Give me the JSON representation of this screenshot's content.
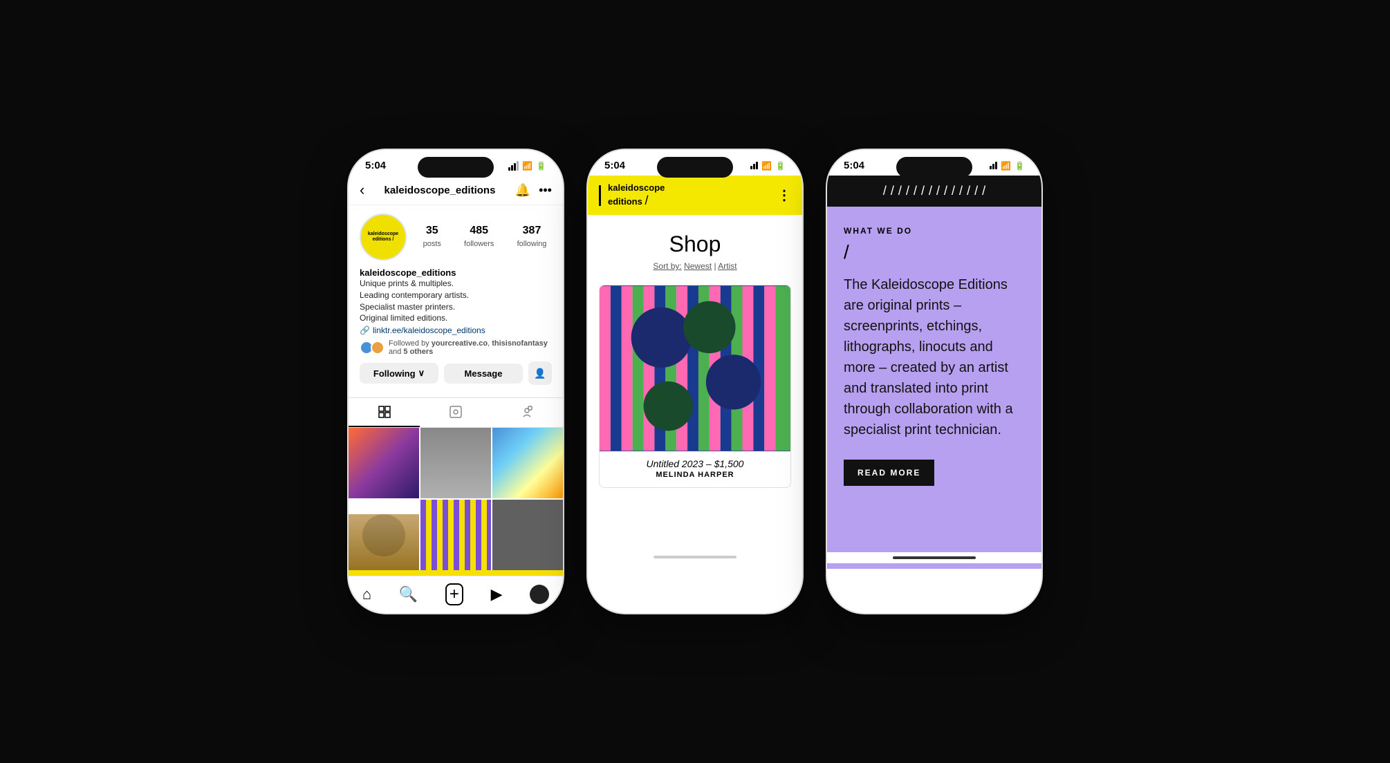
{
  "background": "#0a0a0a",
  "phone1": {
    "statusBar": {
      "time": "5:04",
      "locationArrow": "▲",
      "wifi": "wifi",
      "battery": "battery"
    },
    "header": {
      "back": "‹",
      "username": "kaleidoscope_editions",
      "bellIcon": "🔔",
      "moreIcon": "···"
    },
    "profile": {
      "avatarText": "kaleidoscope editions /",
      "stats": {
        "posts": "35",
        "postsLabel": "posts",
        "followers": "485",
        "followersLabel": "followers",
        "following": "387",
        "followingLabel": "following"
      },
      "name": "kaleidoscope_editions",
      "bio": [
        "Unique prints & multiples.",
        "Leading contemporary artists.",
        "Specialist master printers.",
        "Original limited editions."
      ],
      "link": "linktr.ee/kaleidoscope_editions",
      "followedBy": "Followed by yourcreative.co, thisisnofantasy and 5 others"
    },
    "buttons": {
      "following": "Following",
      "followingChevron": "∨",
      "message": "Message",
      "addIcon": "👤+"
    },
    "bottomNav": {
      "home": "⌂",
      "search": "🔍",
      "plus": "+",
      "reels": "▶",
      "profile": ""
    }
  },
  "phone2": {
    "statusBar": {
      "time": "5:04"
    },
    "header": {
      "logoText1": "kaleidoscope",
      "logoText2": "editions",
      "logoSlash": "/",
      "menuDots": "⋮"
    },
    "shop": {
      "title": "Shop",
      "sortLabel": "Sort by:",
      "sortNewest": "Newest",
      "divider": "|",
      "sortArtist": "Artist"
    },
    "product": {
      "title": "Untitled",
      "year": "2023",
      "dash": "–",
      "price": "$1,500",
      "artist": "MELINDA HARPER"
    }
  },
  "phone3": {
    "statusBar": {
      "time": "5:04"
    },
    "slashes": "/ / / / / / / / / / / / / /",
    "content": {
      "label": "WHAT WE DO",
      "slash": "/",
      "body": "The Kaleidoscope Editions are original prints – screenprints, etchings, lithographs, linocuts and more – created by an artist and translated into print through collaboration with a specialist print technician.",
      "readMoreBtn": "READ MORE"
    }
  }
}
